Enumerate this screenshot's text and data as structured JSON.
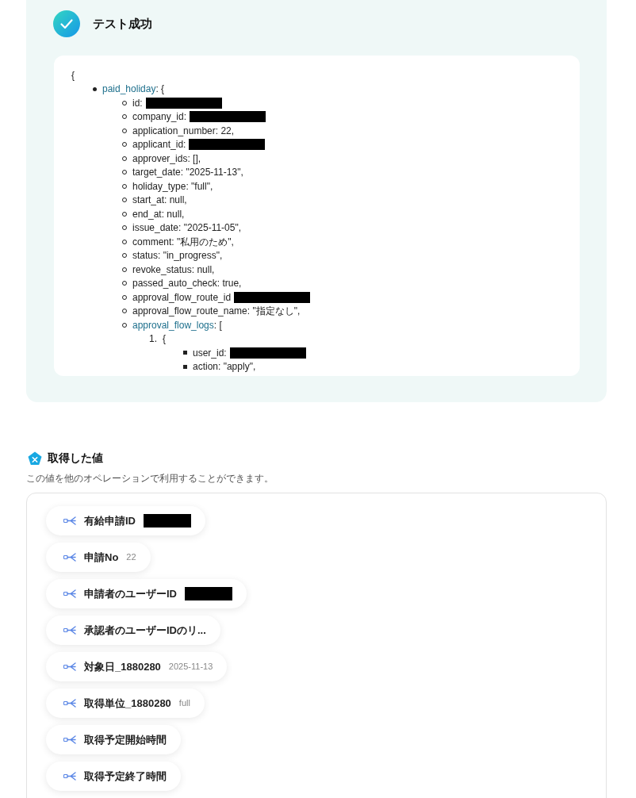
{
  "result": {
    "title": "テスト成功"
  },
  "code_view": {
    "open": "{",
    "items": [
      {
        "kind": "branch",
        "key": "paid_holiday",
        "text": ": {",
        "redacted": false,
        "children": [
          {
            "kind": "field",
            "text": "id:",
            "redacted": true
          },
          {
            "kind": "field",
            "text": "company_id:",
            "redacted": true
          },
          {
            "kind": "field",
            "text": "application_number: 22,",
            "redacted": false
          },
          {
            "kind": "field",
            "text": "applicant_id:",
            "redacted": true
          },
          {
            "kind": "field",
            "text": "approver_ids: [],",
            "redacted": false
          },
          {
            "kind": "field",
            "text": "target_date: \"2025-11-13\",",
            "redacted": false
          },
          {
            "kind": "field",
            "text": "holiday_type: \"full\",",
            "redacted": false
          },
          {
            "kind": "field",
            "text": "start_at: null,",
            "redacted": false
          },
          {
            "kind": "field",
            "text": "end_at: null,",
            "redacted": false
          },
          {
            "kind": "field",
            "text": "issue_date: \"2025-11-05\",",
            "redacted": false
          },
          {
            "kind": "field",
            "text": "comment: \"私用のため\",",
            "redacted": false
          },
          {
            "kind": "field",
            "text": "status: \"in_progress\",",
            "redacted": false
          },
          {
            "kind": "field",
            "text": "revoke_status: null,",
            "redacted": false
          },
          {
            "kind": "field",
            "text": "passed_auto_check: true,",
            "redacted": false
          },
          {
            "kind": "field",
            "text": "approval_flow_route_id",
            "redacted": true
          },
          {
            "kind": "field",
            "text": "approval_flow_route_name: \"指定なし\",",
            "redacted": false
          },
          {
            "kind": "branch",
            "key": "approval_flow_logs",
            "text": ": [",
            "redacted": false,
            "children": [
              {
                "kind": "entry",
                "number": "1.",
                "text": "{",
                "redacted": false,
                "children": [
                  {
                    "kind": "field",
                    "text": "user_id:",
                    "redacted": true
                  },
                  {
                    "kind": "field",
                    "text": "action: \"apply\",",
                    "redacted": false
                  }
                ]
              }
            ]
          }
        ]
      }
    ]
  },
  "outputs": {
    "title": "取得した値",
    "description": "この値を他のオペレーションで利用することができます。",
    "items": [
      {
        "label": "有給申請ID",
        "redacted": true
      },
      {
        "label": "申請No",
        "value": "22",
        "redacted": false
      },
      {
        "label": "申請者のユーザーID",
        "redacted": true
      },
      {
        "label": "承認者のユーザーIDのリ...",
        "redacted": false
      },
      {
        "label": "対象日_1880280",
        "value": "2025-11-13",
        "redacted": false
      },
      {
        "label": "取得単位_1880280",
        "value": "full",
        "redacted": false
      },
      {
        "label": "取得予定開始時間",
        "redacted": false
      },
      {
        "label": "取得予定終了時間",
        "redacted": false
      }
    ]
  }
}
